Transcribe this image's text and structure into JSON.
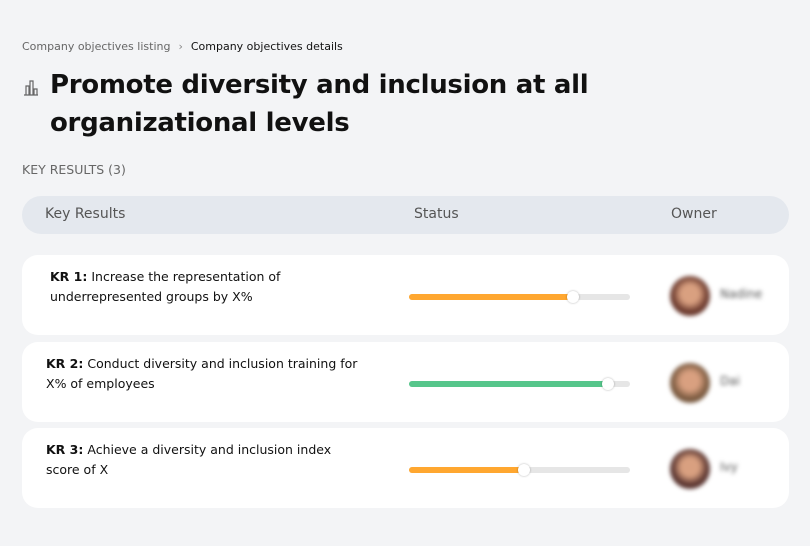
{
  "breadcrumb": {
    "parent": "Company objectives listing",
    "current": "Company objectives details"
  },
  "title": "Promote diversity and inclusion at all organizational levels",
  "title_icon": "building-chart-icon",
  "section_label": "KEY RESULTS (3)",
  "table": {
    "headers": [
      "Key Results",
      "Status",
      "Owner"
    ]
  },
  "key_results": [
    {
      "id": "KR 1:",
      "text": "Increase the representation of underrepresented groups by X%",
      "progress": 74,
      "color": "#ffa730",
      "owner": "Nadine",
      "avatar_color": "#6b3a2e"
    },
    {
      "id": "KR 2:",
      "text": "Conduct diversity and inclusion training for X% of employees",
      "progress": 90,
      "color": "#56c68b",
      "owner": "Dai",
      "avatar_color": "#7a5a40"
    },
    {
      "id": "KR 3:",
      "text": "Achieve a diversity and inclusion index score of X",
      "progress": 52,
      "color": "#ffa730",
      "owner": "Ivy",
      "avatar_color": "#5a3530"
    }
  ]
}
